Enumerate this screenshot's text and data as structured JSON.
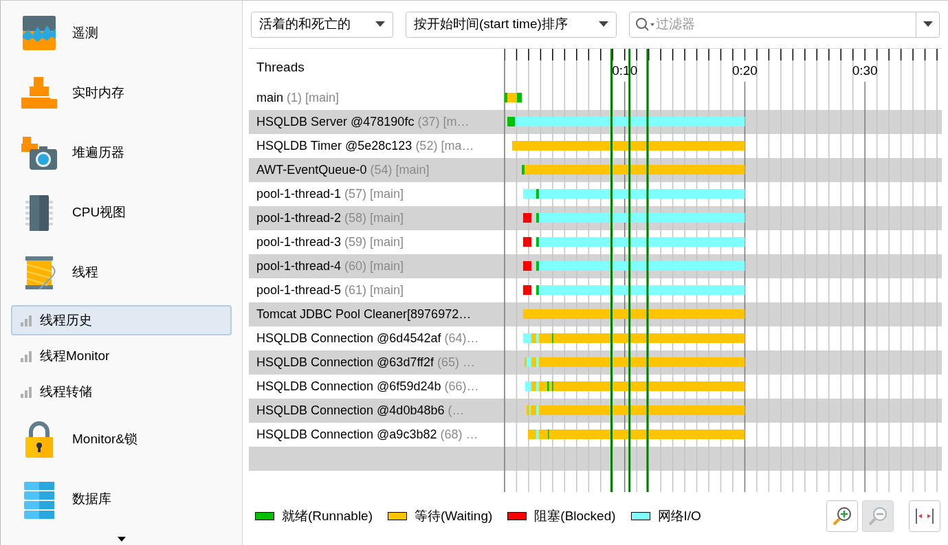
{
  "sidebar": {
    "items": [
      {
        "label": "遥测",
        "kind": "large",
        "selected": false
      },
      {
        "label": "实时内存",
        "kind": "large",
        "selected": false
      },
      {
        "label": "堆遍历器",
        "kind": "large",
        "selected": false
      },
      {
        "label": "CPU视图",
        "kind": "large",
        "selected": false
      },
      {
        "label": "线程",
        "kind": "large",
        "selected": false
      },
      {
        "label": "线程历史",
        "kind": "small",
        "selected": true
      },
      {
        "label": "线程Monitor",
        "kind": "small",
        "selected": false
      },
      {
        "label": "线程转储",
        "kind": "small",
        "selected": false
      },
      {
        "label": "Monitor&锁",
        "kind": "large",
        "selected": false
      },
      {
        "label": "数据库",
        "kind": "large",
        "selected": false
      }
    ]
  },
  "toolbar": {
    "thread_filter": {
      "value": "活着的和死亡的"
    },
    "sort": {
      "value": "按开始时间(start time)排序"
    },
    "filter": {
      "placeholder": "过滤器"
    }
  },
  "timeline": {
    "tick_labels": [
      "0:10",
      "0:20",
      "0:30"
    ]
  },
  "threads": {
    "heading": "Threads",
    "rows": [
      {
        "name": "main",
        "detail": "(1) [main]"
      },
      {
        "name": "HSQLDB Server @478190fc",
        "detail": "(37) [m…"
      },
      {
        "name": "HSQLDB Timer @5e28c123",
        "detail": "(52) [ma…"
      },
      {
        "name": "AWT-EventQueue-0",
        "detail": "(54) [main]"
      },
      {
        "name": "pool-1-thread-1",
        "detail": "(57) [main]"
      },
      {
        "name": "pool-1-thread-2",
        "detail": "(58) [main]"
      },
      {
        "name": "pool-1-thread-3",
        "detail": "(59) [main]"
      },
      {
        "name": "pool-1-thread-4",
        "detail": "(60) [main]"
      },
      {
        "name": "pool-1-thread-5",
        "detail": "(61) [main]"
      },
      {
        "name": "Tomcat JDBC Pool Cleaner[8976972…"
      },
      {
        "name": "HSQLDB Connection @6d4542af",
        "detail": "(64)…"
      },
      {
        "name": "HSQLDB Connection @63d7ff2f",
        "detail": "(65) …"
      },
      {
        "name": "HSQLDB Connection @6f59d24b",
        "detail": "(66)…"
      },
      {
        "name": "HSQLDB Connection @4d0b48b6",
        "detail": "(…"
      },
      {
        "name": "HSQLDB Connection @a9c3b82",
        "detail": "(68) …"
      }
    ]
  },
  "legend": [
    {
      "label": "就绪(Runnable)",
      "color": "#00c000"
    },
    {
      "label": "等待(Waiting)",
      "color": "#ffc400"
    },
    {
      "label": "阻塞(Blocked)",
      "color": "#ff0000"
    },
    {
      "label": "网络I/O",
      "color": "#80ffff"
    }
  ],
  "buttons": [
    {
      "kind": "zoom_in",
      "disabled": false
    },
    {
      "kind": "zoom_out",
      "disabled": true
    },
    {
      "kind": "fit",
      "disabled": false
    }
  ]
}
